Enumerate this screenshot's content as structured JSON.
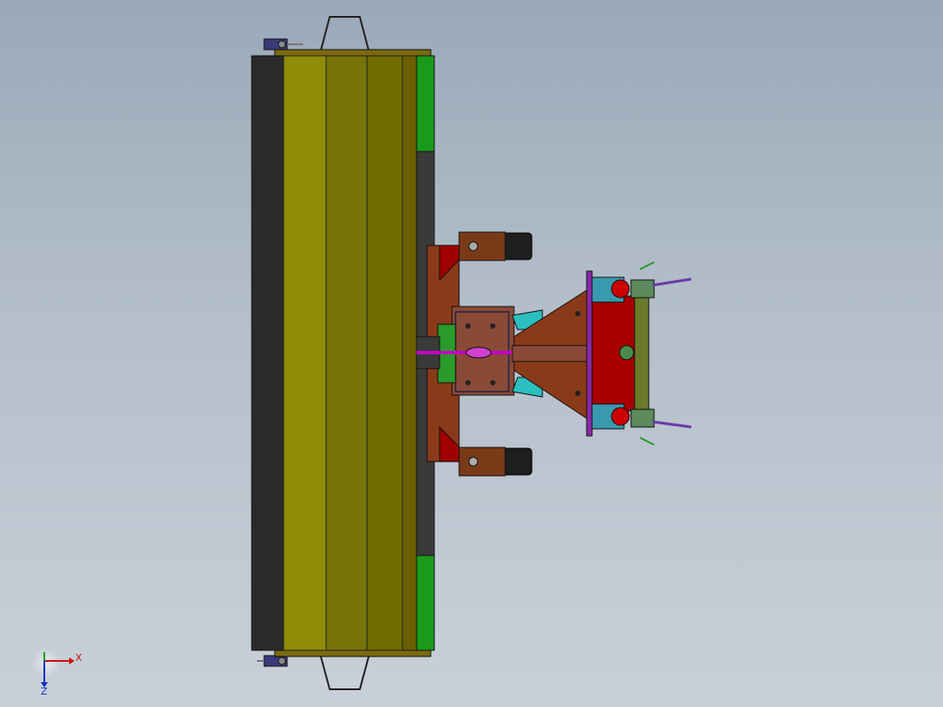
{
  "viewport": {
    "background_top": "#9aa8b8",
    "background_bottom": "#c9d0d8"
  },
  "model": {
    "colors": {
      "black_panel": "#2a2a2a",
      "blade_light": "#8f8c08",
      "blade_dark": "#6f6c00",
      "green_strip": "#1a9a1a",
      "frame_brown": "#8a3a18",
      "frame_dark_brown": "#6a2e14",
      "red_block": "#a80000",
      "teal": "#2bbfc0",
      "magenta": "#c000c0",
      "pale_green": "#5c8a5c",
      "purple": "#6a3aa8",
      "wheel": "#1e1e1e"
    }
  },
  "triad": {
    "x_label": "X",
    "z_label": "Z",
    "x_color": "#cc1010",
    "y_color": "#10a010",
    "z_color": "#1030c8"
  }
}
